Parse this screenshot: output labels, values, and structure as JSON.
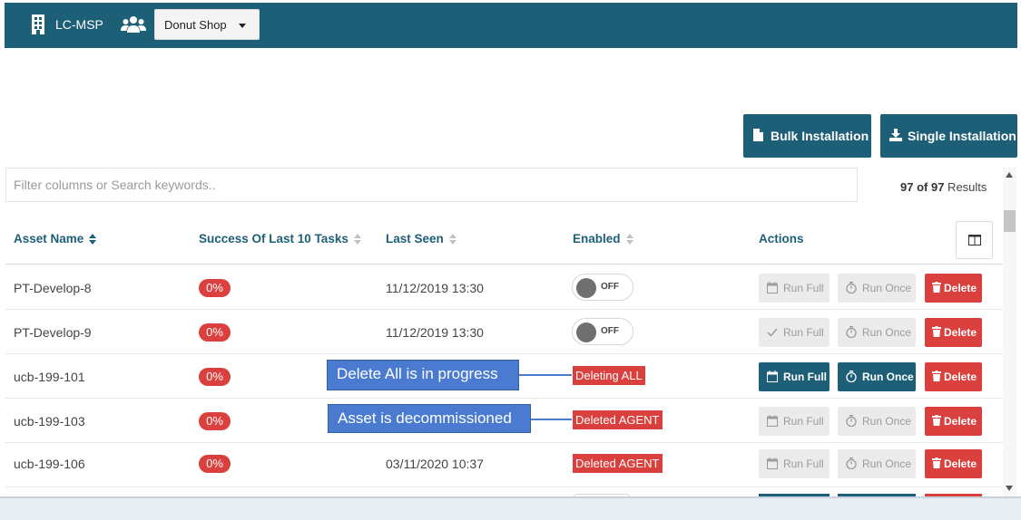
{
  "topbar": {
    "brand": "LC-MSP",
    "shop": "Donut Shop"
  },
  "buttons": {
    "bulk": "Bulk Installation",
    "single": "Single Installation"
  },
  "filter": {
    "placeholder": "Filter columns or Search keywords.."
  },
  "results": {
    "shown": "97",
    "of": " of ",
    "total": "97",
    "suffix": " Results"
  },
  "columns": {
    "asset": "Asset Name",
    "success": "Success Of Last 10 Tasks",
    "lastseen": "Last Seen",
    "enabled": "Enabled",
    "actions": "Actions"
  },
  "actions": {
    "run_full": "Run Full",
    "run_once": "Run Once",
    "delete": "Delete"
  },
  "rows": [
    {
      "name": "PT-Develop-8",
      "success": "0%",
      "last_seen": "11/12/2019 13:30",
      "enabled": "OFF"
    },
    {
      "name": "PT-Develop-9",
      "success": "0%",
      "last_seen": "11/12/2019 13:30",
      "enabled": "OFF"
    },
    {
      "name": "ucb-199-101",
      "success": "0%",
      "last_seen": "",
      "status": "Deleting ALL"
    },
    {
      "name": "ucb-199-103",
      "success": "0%",
      "last_seen": "",
      "status": "Deleted AGENT"
    },
    {
      "name": "ucb-199-106",
      "success": "0%",
      "last_seen": "03/11/2020 10:37",
      "status": "Deleted AGENT"
    }
  ],
  "callouts": {
    "delete_all": "Delete All is in progress",
    "decommissioned": "Asset is decommissioned"
  },
  "colors": {
    "primary": "#1e5f78",
    "danger": "#d9403e",
    "callout": "#4a7bd0"
  }
}
